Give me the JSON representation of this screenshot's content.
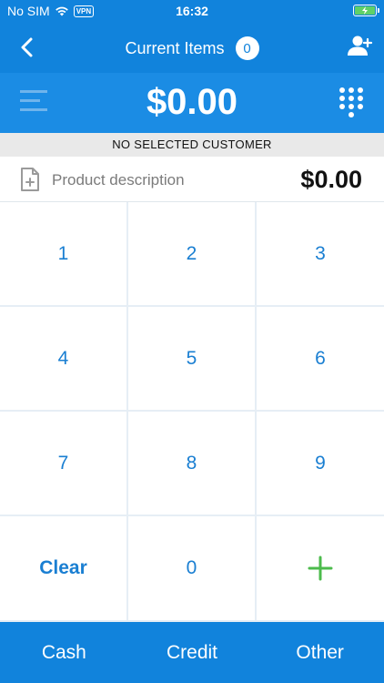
{
  "status_bar": {
    "carrier": "No SIM",
    "vpn": "VPN",
    "time": "16:32",
    "battery_state": "charging"
  },
  "nav": {
    "title": "Current Items",
    "item_count": "0",
    "back_icon": "chevron-left-icon",
    "add_customer_icon": "add-user-icon"
  },
  "amount": {
    "total": "$0.00",
    "menu_icon": "list-menu-icon",
    "keypad_icon": "dialpad-icon"
  },
  "customer": {
    "label": "NO SELECTED CUSTOMER"
  },
  "product": {
    "icon": "add-document-icon",
    "placeholder": "Product description",
    "price": "$0.00"
  },
  "keypad": {
    "keys": [
      "1",
      "2",
      "3",
      "4",
      "5",
      "6",
      "7",
      "8",
      "9",
      "Clear",
      "0"
    ],
    "add_icon": "plus-icon"
  },
  "payment": {
    "cash": "Cash",
    "credit": "Credit",
    "other": "Other"
  },
  "colors": {
    "primary": "#1183dc",
    "amount_bg": "#1b8ce4",
    "key_text": "#1a7fd2",
    "add_green": "#4cbb4c",
    "customer_bg": "#e9e9e9"
  }
}
